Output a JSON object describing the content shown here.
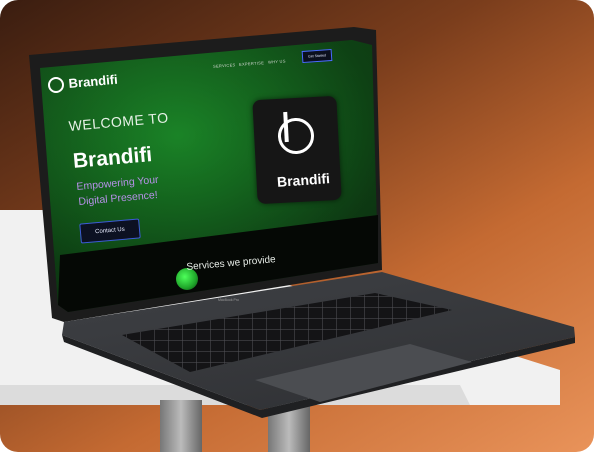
{
  "nav": {
    "brand": "Brandifi",
    "links": [
      "SERVICES",
      "EXPERTISE",
      "WHY US"
    ],
    "cta": "Get Started"
  },
  "hero": {
    "welcome": "WELCOME TO",
    "brand": "Brandifi",
    "tagline_line1": "Empowering Your",
    "tagline_line2": "Digital Presence!",
    "contact_button": "Contact Us"
  },
  "logo_tile": {
    "text": "Brandifi"
  },
  "services": {
    "heading": "Services we provide"
  },
  "device": {
    "label": "MacBook Pro"
  },
  "colors": {
    "accent_green": "#3ecf47",
    "tagline_purple": "#b691e8",
    "button_border_blue": "#3c5bd6",
    "background_orange": "#e9935a"
  }
}
